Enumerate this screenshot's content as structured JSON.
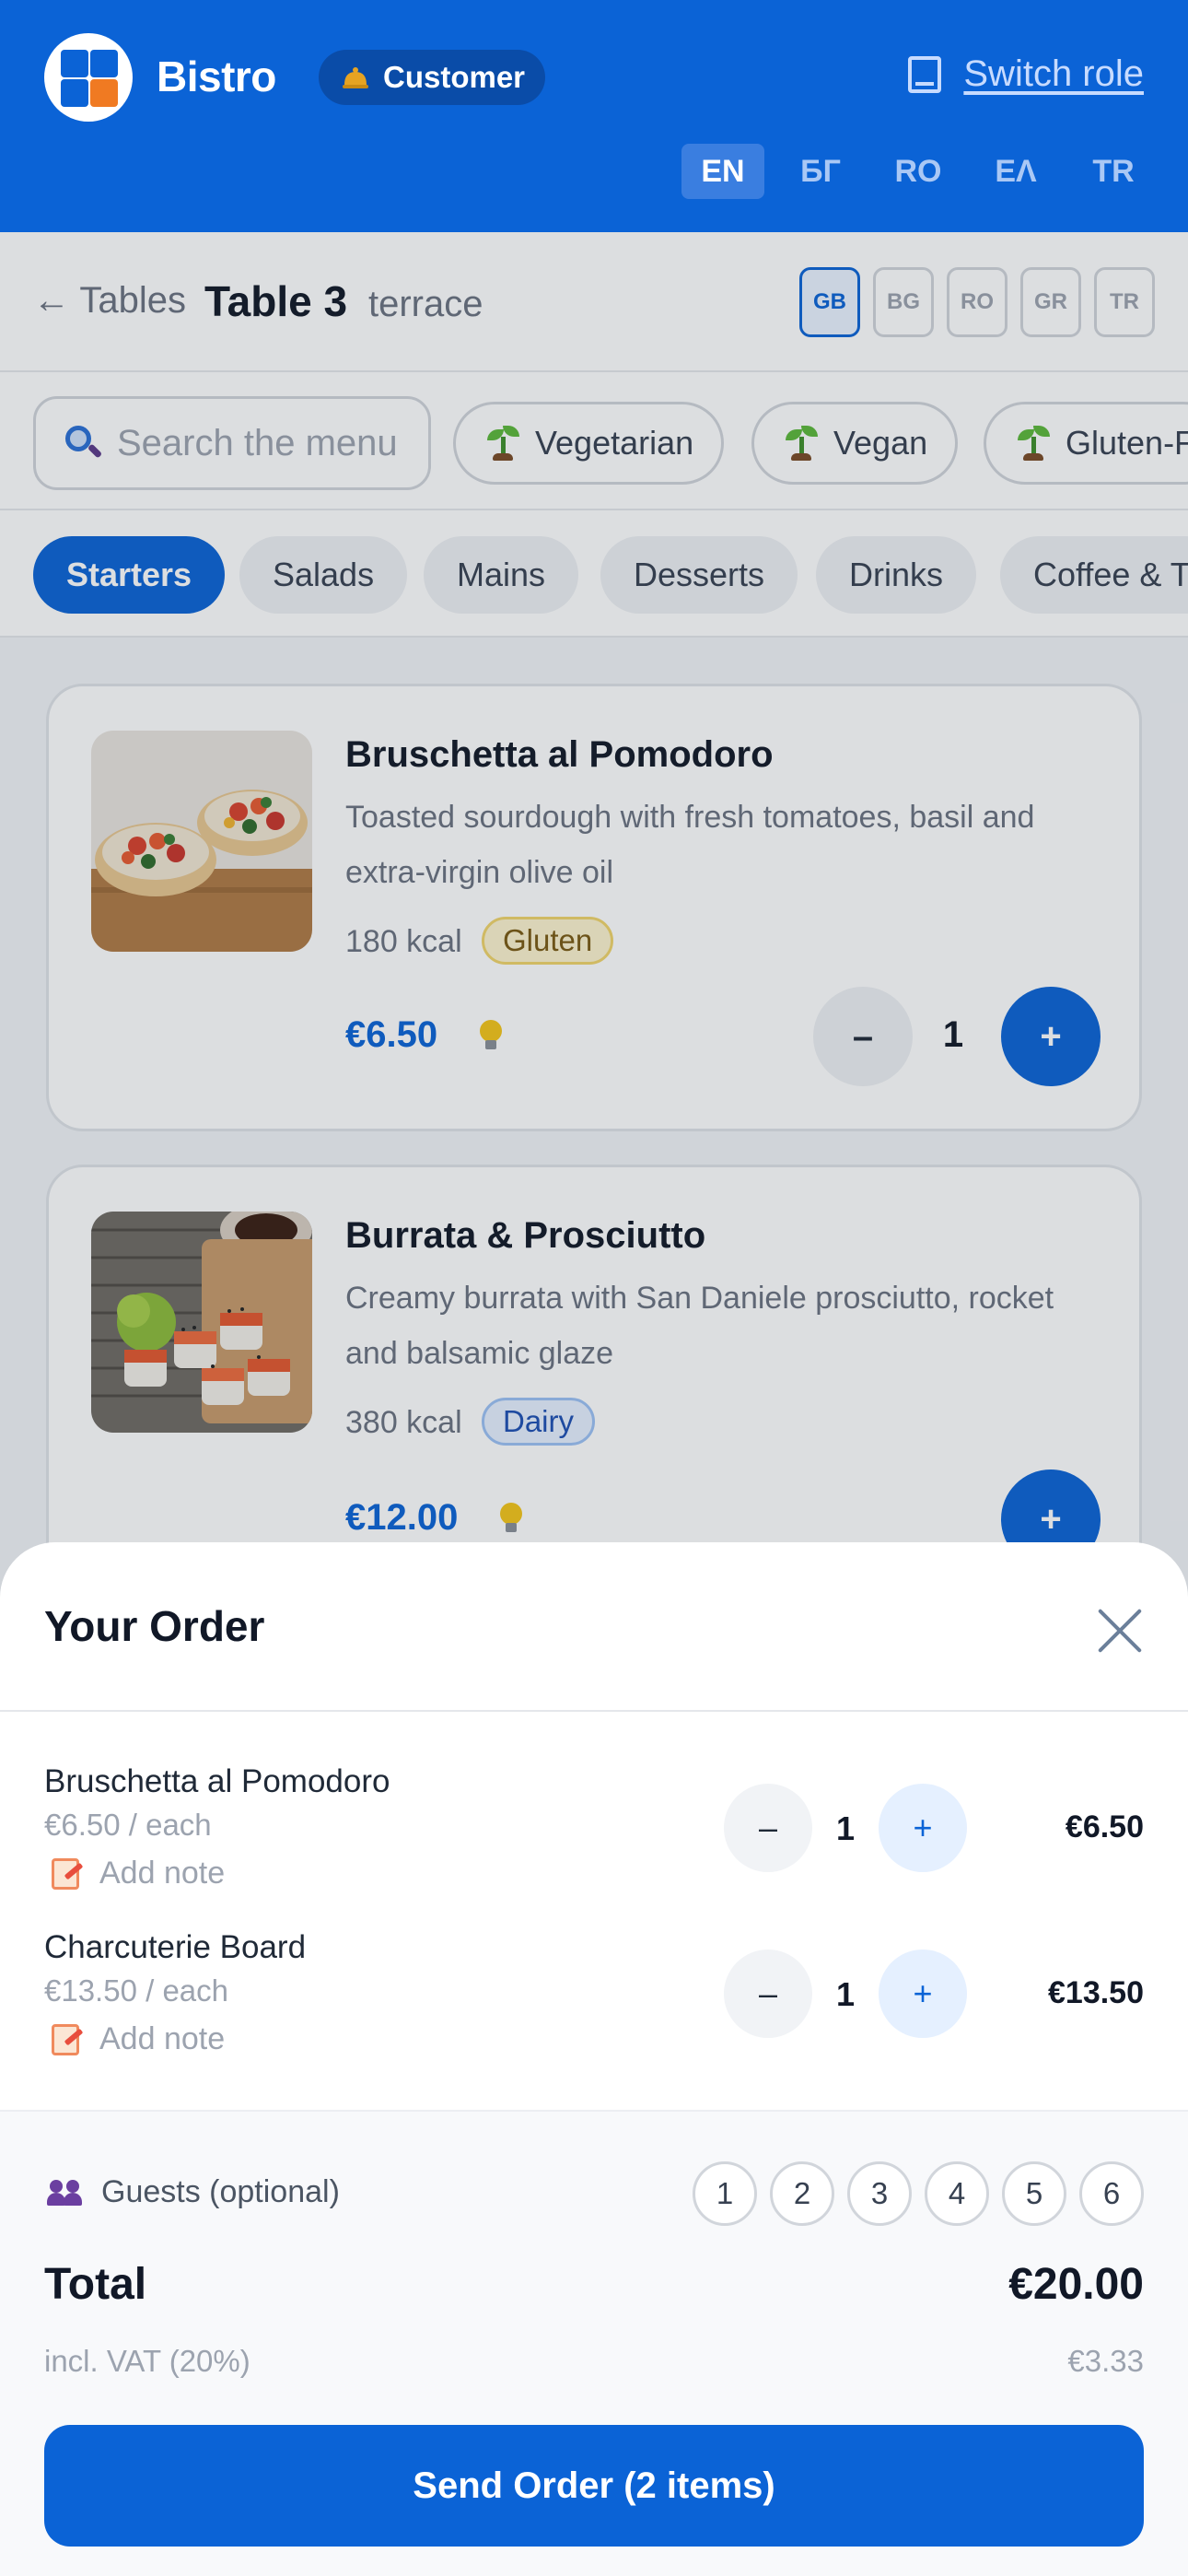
{
  "header": {
    "brand": "Bistro",
    "role_badge": "Customer",
    "switch_role": "Switch role",
    "languages": [
      "EN",
      "БГ",
      "RO",
      "ΕΛ",
      "TR"
    ],
    "active_language": "EN"
  },
  "table_bar": {
    "back_label": "← Tables",
    "table_name": "Table 3",
    "table_area": "terrace",
    "flags": [
      "GB",
      "BG",
      "RO",
      "GR",
      "TR"
    ],
    "active_flag": "GB"
  },
  "filters": {
    "search_placeholder": "Search the menu",
    "diet_chips": [
      "Vegetarian",
      "Vegan",
      "Gluten-F"
    ]
  },
  "categories": [
    "Starters",
    "Salads",
    "Mains",
    "Desserts",
    "Drinks",
    "Coffee & T"
  ],
  "active_category": "Starters",
  "menu": [
    {
      "name": "Bruschetta al Pomodoro",
      "desc_line1": "Toasted sourdough with fresh tomatoes, basil and",
      "desc_line2": "extra-virgin olive oil",
      "kcal": "180 kcal",
      "allergen": "Gluten",
      "price": "€6.50",
      "qty": "1",
      "minus": "–",
      "plus": "+"
    },
    {
      "name": "Burrata & Prosciutto",
      "desc_line1": "Creamy burrata with San Daniele prosciutto, rocket",
      "desc_line2": "and balsamic glaze",
      "kcal": "380 kcal",
      "allergen": "Dairy",
      "price": "€12.00",
      "plus": "+"
    }
  ],
  "order": {
    "title": "Your Order",
    "items": [
      {
        "name": "Bruschetta al Pomodoro",
        "each": "€6.50 / each",
        "note": "Add note",
        "qty": "1",
        "line_total": "€6.50",
        "minus": "–",
        "plus": "+"
      },
      {
        "name": "Charcuterie Board",
        "each": "€13.50 / each",
        "note": "Add note",
        "qty": "1",
        "line_total": "€13.50",
        "minus": "–",
        "plus": "+"
      }
    ],
    "guests_label": "Guests (optional)",
    "guest_options": [
      "1",
      "2",
      "3",
      "4",
      "5",
      "6"
    ],
    "total_label": "Total",
    "total_value": "€20.00",
    "vat_label": "incl. VAT (20%)",
    "vat_value": "€3.33",
    "send_button": "Send Order (2 items)"
  },
  "colors": {
    "primary": "#0b63d6",
    "accent_logo": "#f07a22",
    "text": "#111827",
    "muted": "#6b7280"
  }
}
